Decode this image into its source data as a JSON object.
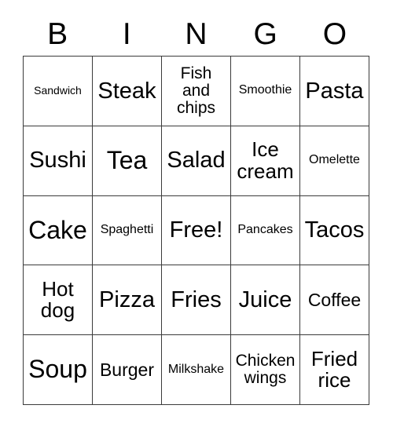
{
  "card": {
    "header": {
      "letters": [
        "B",
        "I",
        "N",
        "G",
        "O"
      ]
    },
    "rows": [
      [
        {
          "label": "Sandwich",
          "size": "fs-xs"
        },
        {
          "label": "Steak",
          "size": "fs-xl"
        },
        {
          "label": "Fish\nand\nchips",
          "size": "fs-m"
        },
        {
          "label": "Smoothie",
          "size": "fs-s"
        },
        {
          "label": "Pasta",
          "size": "fs-xl"
        }
      ],
      [
        {
          "label": "Sushi",
          "size": "fs-xl"
        },
        {
          "label": "Tea",
          "size": "fs-xxl"
        },
        {
          "label": "Salad",
          "size": "fs-xl"
        },
        {
          "label": "Ice\ncream",
          "size": "fs-l"
        },
        {
          "label": "Omelette",
          "size": "fs-s"
        }
      ],
      [
        {
          "label": "Cake",
          "size": "fs-xxl"
        },
        {
          "label": "Spaghetti",
          "size": "fs-s"
        },
        {
          "label": "Free!",
          "size": "fs-xl"
        },
        {
          "label": "Pancakes",
          "size": "fs-s"
        },
        {
          "label": "Tacos",
          "size": "fs-xl"
        }
      ],
      [
        {
          "label": "Hot\ndog",
          "size": "fs-l"
        },
        {
          "label": "Pizza",
          "size": "fs-xl"
        },
        {
          "label": "Fries",
          "size": "fs-xl"
        },
        {
          "label": "Juice",
          "size": "fs-xl"
        },
        {
          "label": "Coffee",
          "size": "fs-ml"
        }
      ],
      [
        {
          "label": "Soup",
          "size": "fs-xxl"
        },
        {
          "label": "Burger",
          "size": "fs-ml"
        },
        {
          "label": "Milkshake",
          "size": "fs-s"
        },
        {
          "label": "Chicken\nwings",
          "size": "fs-m"
        },
        {
          "label": "Fried\nrice",
          "size": "fs-l"
        }
      ]
    ]
  }
}
